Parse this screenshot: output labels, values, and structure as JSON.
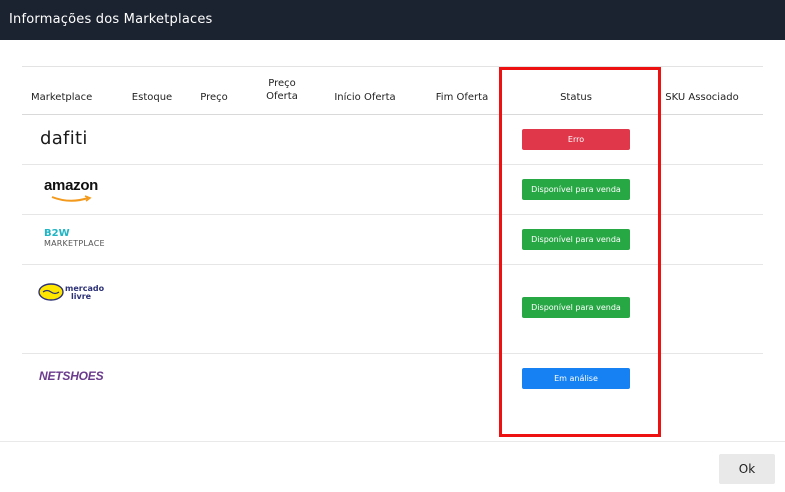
{
  "window": {
    "title": "Informações dos Marketplaces"
  },
  "table": {
    "headers": {
      "marketplace": "Marketplace",
      "estoque": "Estoque",
      "preco": "Preço",
      "preco_oferta_line1": "Preço",
      "preco_oferta_line2": "Oferta",
      "inicio_oferta": "Início Oferta",
      "fim_oferta": "Fim Oferta",
      "status": "Status",
      "sku": "SKU Associado"
    },
    "rows": [
      {
        "marketplace": "dafiti",
        "status": "Erro",
        "status_color": "#e0374b"
      },
      {
        "marketplace": "amazon",
        "status": "Disponível para venda",
        "status_color": "#28a745"
      },
      {
        "marketplace_line1": "B2W",
        "marketplace_line2": "MARKETPLACE",
        "status": "Disponível para venda",
        "status_color": "#28a745"
      },
      {
        "marketplace_line1": "mercado",
        "marketplace_line2": "livre",
        "status": "Disponível para venda",
        "status_color": "#28a745"
      },
      {
        "marketplace": "NETSHOES",
        "status": "Em análise",
        "status_color": "#1581f3"
      }
    ]
  },
  "footer": {
    "ok_label": "Ok"
  },
  "colors": {
    "header_bg": "#1c2330",
    "highlight": "#ee1111"
  }
}
